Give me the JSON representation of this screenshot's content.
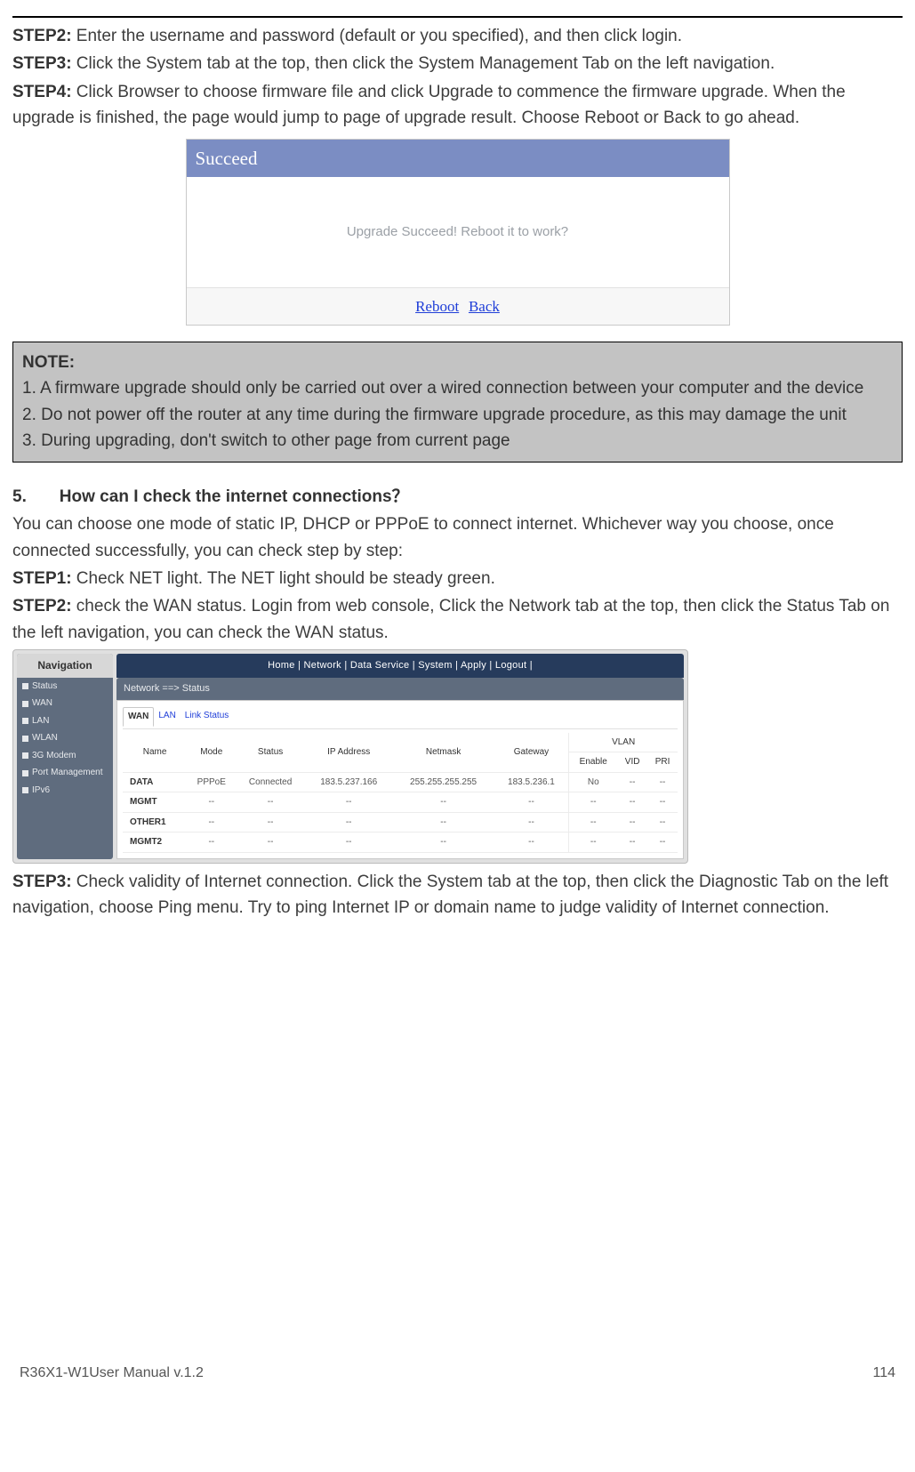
{
  "steps_top": [
    {
      "label": "STEP2:",
      "text": " Enter the username and password (default or you specified), and then click login."
    },
    {
      "label": "STEP3:",
      "text": " Click the System tab at the top, then click the System Management Tab on the left navigation."
    },
    {
      "label": "STEP4:",
      "text": " Click Browser to choose firmware file and click Upgrade to commence the firmware upgrade. When the upgrade is finished, the page would jump to page of upgrade result. Choose Reboot or Back to go ahead."
    }
  ],
  "succeed": {
    "title": "Succeed",
    "message": "Upgrade Succeed! Reboot it to work?",
    "reboot": "Reboot",
    "back": "Back"
  },
  "note": {
    "header": "NOTE:",
    "items": [
      "1. A firmware upgrade should only be carried out over a wired connection between your computer and the device",
      "2. Do not power off the router at any time during the firmware upgrade procedure, as this may damage the unit",
      "3. During upgrading, don't switch to other page from current page"
    ]
  },
  "q5": {
    "title": "5.       How can I check the internet connections？",
    "intro": "You can choose one mode of static IP, DHCP or PPPoE to connect internet. Whichever way you choose, once connected successfully, you can check step by step:",
    "steps": [
      {
        "label": "STEP1:",
        "text": " Check NET light. The NET light should be steady green."
      },
      {
        "label": "STEP2:",
        "text": " check the WAN status. Login from web console, Click the Network tab at the top, then click the Status Tab on the left navigation, you can check the WAN status."
      }
    ],
    "step3": {
      "label": "STEP3:",
      "text": " Check validity of Internet connection. Click the System tab at the top, then click the Diagnostic Tab on the left navigation, choose Ping menu. Try to ping Internet IP or domain name to judge validity of Internet connection."
    }
  },
  "router": {
    "topnav": "Home  | Network  | Data Service  | System  | Apply   | Logout  |",
    "nav_title": "Navigation",
    "nav_items": [
      "Status",
      "WAN",
      "LAN",
      "WLAN",
      "3G Modem",
      "Port Management",
      "IPv6"
    ],
    "breadcrumb": "Network ==> Status",
    "tabs": [
      "WAN",
      "LAN",
      "Link Status"
    ],
    "active_tab": "WAN",
    "columns": [
      "Name",
      "Mode",
      "Status",
      "IP Address",
      "Netmask",
      "Gateway",
      "VLAN",
      "Enable",
      "VID",
      "PRI"
    ],
    "header_simple": [
      "Name",
      "Mode",
      "Status",
      "IP Address",
      "Netmask",
      "Gateway"
    ],
    "header_vlan_group": "VLAN",
    "header_vlan_sub": [
      "Enable",
      "VID",
      "PRI"
    ],
    "rows": [
      {
        "Name": "DATA",
        "Mode": "PPPoE",
        "Status": "Connected",
        "IP": "183.5.237.166",
        "Netmask": "255.255.255.255",
        "Gateway": "183.5.236.1",
        "Enable": "No",
        "VID": "--",
        "PRI": "--"
      },
      {
        "Name": "MGMT",
        "Mode": "--",
        "Status": "--",
        "IP": "--",
        "Netmask": "--",
        "Gateway": "--",
        "Enable": "--",
        "VID": "--",
        "PRI": "--"
      },
      {
        "Name": "OTHER1",
        "Mode": "--",
        "Status": "--",
        "IP": "--",
        "Netmask": "--",
        "Gateway": "--",
        "Enable": "--",
        "VID": "--",
        "PRI": "--"
      },
      {
        "Name": "MGMT2",
        "Mode": "--",
        "Status": "--",
        "IP": "--",
        "Netmask": "--",
        "Gateway": "--",
        "Enable": "--",
        "VID": "--",
        "PRI": "--"
      }
    ]
  },
  "footer": {
    "left": "R36X1-W1User Manual v.1.2",
    "right": "114"
  }
}
